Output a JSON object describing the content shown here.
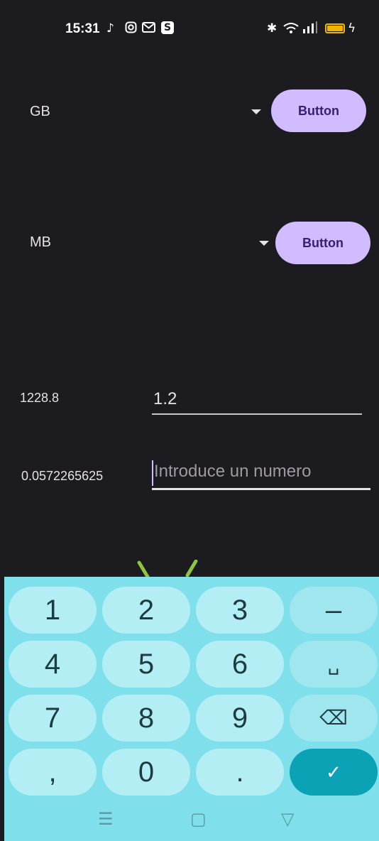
{
  "status_bar": {
    "time": "15:31",
    "left_icons": [
      "tiktok-icon",
      "instagram-icon",
      "gmail-icon",
      "s-app-icon"
    ],
    "s_badge": "S",
    "right_icons": [
      "bluetooth-icon",
      "wifi-icon",
      "signal-icon",
      "battery-icon",
      "charging-icon"
    ]
  },
  "converter": {
    "row1": {
      "unit": "GB",
      "button": "Button"
    },
    "row2": {
      "unit": "MB",
      "button": "Button"
    },
    "result1": "1228.8",
    "input1_value": "1.2",
    "result2": "0.0572265625",
    "input2_placeholder": "Introduce un numero"
  },
  "keyboard": {
    "keys": [
      "1",
      "2",
      "3",
      "–",
      "4",
      "5",
      "6",
      "␣",
      "7",
      "8",
      "9",
      "⌫",
      ",",
      "0",
      ".",
      "✓"
    ]
  },
  "nav_bar": {
    "menu": "☰",
    "home": "▢",
    "back": "▽"
  },
  "colors": {
    "background": "#1c1b1f",
    "button_bg": "#d0bcff",
    "button_text": "#381e72",
    "keyboard_bg": "#7fdfea",
    "key_bg": "#b2eef3",
    "ok_key_bg": "#0aa2b4"
  }
}
